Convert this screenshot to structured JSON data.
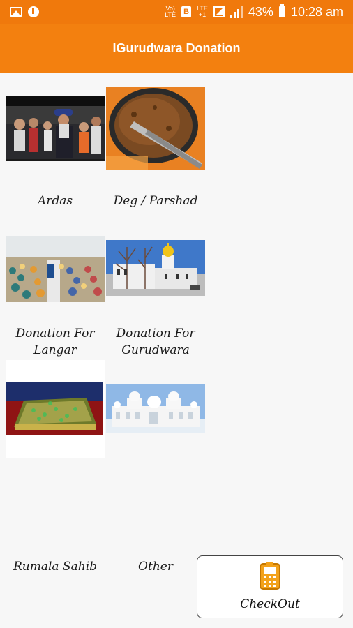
{
  "status_bar": {
    "tag_top": "Vo)",
    "tag_bottom": "LTE",
    "box_letter": "B",
    "lte_top": "LTE",
    "lte_bottom": "+1",
    "battery_percent": "43%",
    "time": "10:28 am"
  },
  "app_bar": {
    "title": "IGurudwara Donation"
  },
  "tiles": [
    {
      "label": "Ardas"
    },
    {
      "label": "Deg / Parshad"
    },
    {
      "label": "Donation For Langar"
    },
    {
      "label": "Donation For Gurudwara"
    },
    {
      "label": "Rumala Sahib"
    },
    {
      "label": "Other"
    }
  ],
  "checkout": {
    "label": "CheckOut",
    "icon": "card-terminal-icon"
  }
}
